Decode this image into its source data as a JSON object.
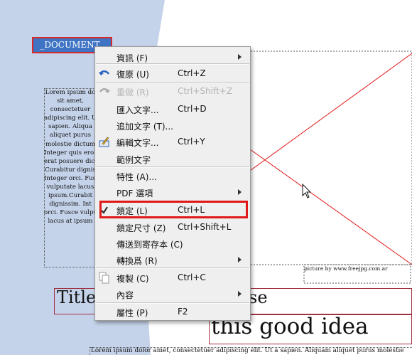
{
  "document": {
    "frame_label": "_DOCUMENT_",
    "lorem_lines": [
      "Lorem ipsum do",
      "sit amet,",
      "consectetuer",
      "adipiscing elit. U",
      "sapien. Aliqua",
      "aliquet purus",
      "molestie dictum",
      "Integer quis eros",
      "erat posuere dict",
      "Curabitur dignis",
      "Integer orci. Fusc",
      "vulputate lacus",
      "ipsum.Curabit",
      "dignissim. Int",
      "orci. Fusce vulpu",
      "lacus at ipsum"
    ],
    "image_caption": "picture by www.freejpg.com.ar",
    "title_left": "Title",
    "title_right": "se",
    "headline": "this good idea",
    "bottom_text": "Lorem ipsum dolor amet, consectetuer adipiscing elit. Ut a sapien. Aliquam aliquet purus molestie"
  },
  "menu": {
    "items": [
      {
        "label": "資訊 (F)",
        "shortcut": "",
        "submenu": true,
        "enabled": true,
        "icon": ""
      },
      {
        "label": "復原 (U)",
        "shortcut": "Ctrl+Z",
        "submenu": false,
        "enabled": true,
        "icon": "undo-arrow-icon"
      },
      {
        "label": "重做 (R)",
        "shortcut": "Ctrl+Shift+Z",
        "submenu": false,
        "enabled": false,
        "icon": "redo-arrow-icon"
      },
      {
        "label": "匯入文字...",
        "shortcut": "Ctrl+D",
        "submenu": false,
        "enabled": true,
        "icon": ""
      },
      {
        "label": "追加文字 (T)...",
        "shortcut": "",
        "submenu": false,
        "enabled": true,
        "icon": ""
      },
      {
        "label": "編輯文字...",
        "shortcut": "Ctrl+Y",
        "submenu": false,
        "enabled": true,
        "icon": "edit-text-icon"
      },
      {
        "label": "範例文字",
        "shortcut": "",
        "submenu": false,
        "enabled": true,
        "icon": ""
      },
      {
        "label": "特性 (A)...",
        "shortcut": "",
        "submenu": false,
        "enabled": true,
        "icon": ""
      },
      {
        "label": "PDF 選項",
        "shortcut": "",
        "submenu": true,
        "enabled": true,
        "icon": ""
      },
      {
        "label": "鎖定 (L)",
        "shortcut": "Ctrl+L",
        "submenu": false,
        "enabled": true,
        "icon": "checkmark-icon",
        "checked": true
      },
      {
        "label": "鎖定尺寸 (Z)",
        "shortcut": "Ctrl+Shift+L",
        "submenu": false,
        "enabled": true,
        "icon": ""
      },
      {
        "label": "傳送到寄存本 (C)",
        "shortcut": "",
        "submenu": false,
        "enabled": true,
        "icon": ""
      },
      {
        "label": "轉換爲 (R)",
        "shortcut": "",
        "submenu": true,
        "enabled": true,
        "icon": ""
      },
      {
        "label": "複製 (C)",
        "shortcut": "Ctrl+C",
        "submenu": false,
        "enabled": true,
        "icon": "copy-icon"
      },
      {
        "label": "內容",
        "shortcut": "",
        "submenu": true,
        "enabled": true,
        "icon": ""
      },
      {
        "label": "屬性 (P)",
        "shortcut": "F2",
        "submenu": false,
        "enabled": true,
        "icon": ""
      }
    ]
  },
  "colors": {
    "page_blue": "#c5d3ea",
    "frame_red": "#e01818",
    "menu_bg": "#efefef"
  }
}
